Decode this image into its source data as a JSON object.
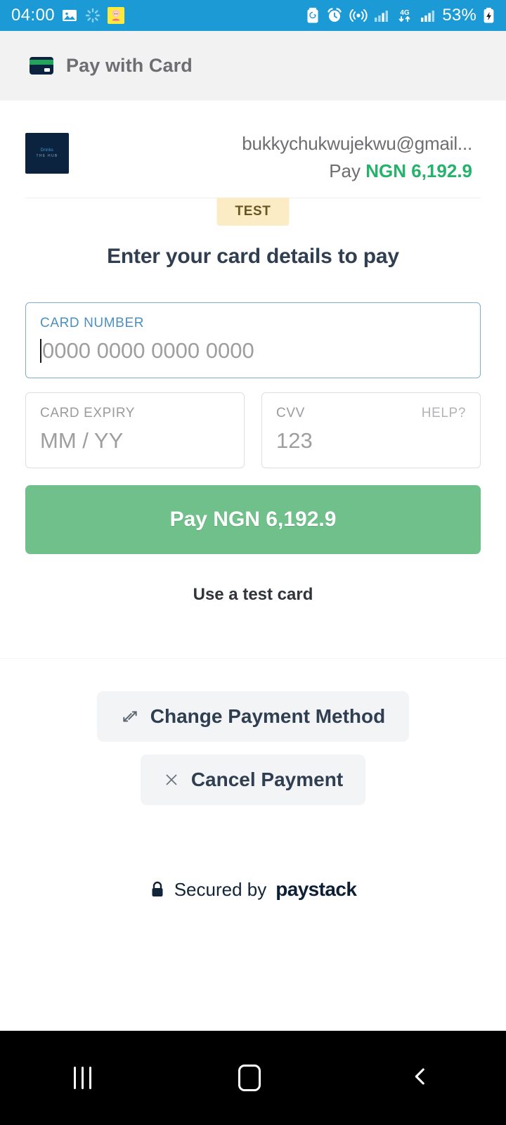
{
  "statusbar": {
    "time": "04:00",
    "battery_percent": "53%",
    "icons": [
      "image-icon",
      "loading-spinner-icon",
      "avatar-emoji-icon",
      "battery-saver-icon",
      "alarm-clock-icon",
      "hotspot-icon",
      "signal-bars-icon",
      "network-4g-icon",
      "signal-bars-2-icon",
      "battery-charging-icon"
    ],
    "network_label": "4G",
    "bar_color": "#1c9ad6"
  },
  "header": {
    "title": "Pay with Card",
    "icon": "credit-card-icon"
  },
  "merchant": {
    "logo_line1": "Drinks",
    "logo_line2": "THE HUB",
    "email": "bukkychukwujekwu@gmail...",
    "pay_prefix": "Pay",
    "amount": "NGN 6,192.9",
    "amount_color": "#25b36b",
    "test_badge": "TEST",
    "test_badge_bg": "#fbecc6"
  },
  "main": {
    "heading": "Enter your card details to pay",
    "fields": {
      "card_number": {
        "label": "CARD NUMBER",
        "placeholder": "0000 0000 0000 0000",
        "value": "",
        "focused": true
      },
      "card_expiry": {
        "label": "CARD EXPIRY",
        "placeholder": "MM / YY",
        "value": ""
      },
      "cvv": {
        "label": "CVV",
        "help_label": "HELP?",
        "placeholder": "123",
        "value": ""
      }
    },
    "pay_button": {
      "label": "Pay NGN 6,192.9",
      "color": "#6fc08a"
    },
    "test_card_link": "Use a test card"
  },
  "actions": {
    "change_payment_method": {
      "label": "Change Payment Method",
      "icon": "swap-arrows-icon"
    },
    "cancel_payment": {
      "label": "Cancel Payment",
      "icon": "close-x-icon"
    }
  },
  "footer": {
    "secured_text": "Secured by",
    "brand": "paystack",
    "icon": "lock-icon"
  },
  "navbar": {
    "recents": "recents-button",
    "home": "home-button",
    "back": "back-button"
  }
}
